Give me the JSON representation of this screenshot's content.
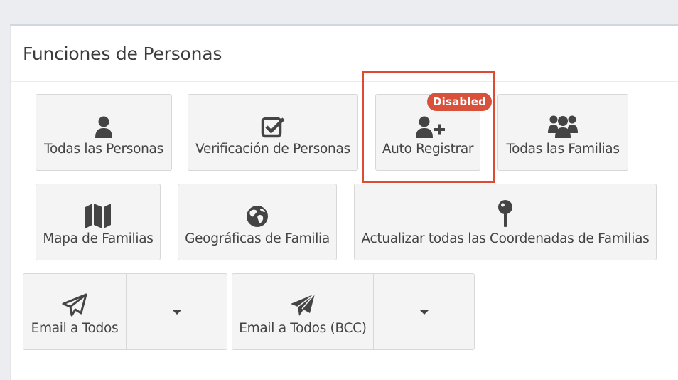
{
  "panel": {
    "title": "Funciones de Personas"
  },
  "buttons": {
    "all_people": {
      "label": "Todas las Personas",
      "icon": "user-icon"
    },
    "verify_people": {
      "label": "Verificación de Personas",
      "icon": "check-square-icon"
    },
    "self_register": {
      "label": "Auto Registrar",
      "icon": "user-plus-icon",
      "badge": "Disabled"
    },
    "all_families": {
      "label": "Todas las Familias",
      "icon": "users-icon"
    },
    "family_map": {
      "label": "Mapa de Familias",
      "icon": "map-icon"
    },
    "family_geo": {
      "label": "Geográficas de Familia",
      "icon": "globe-icon"
    },
    "update_coords": {
      "label": "Actualizar todas las Coordenadas de Familias",
      "icon": "map-pin-icon"
    },
    "email_all": {
      "label": "Email a Todos",
      "icon": "paper-plane-outline-icon"
    },
    "email_all_bcc": {
      "label": "Email a Todos (BCC)",
      "icon": "paper-plane-icon"
    }
  },
  "colors": {
    "badge": "#d9513b",
    "highlight": "#e14a32",
    "button_bg": "#f4f4f4"
  }
}
